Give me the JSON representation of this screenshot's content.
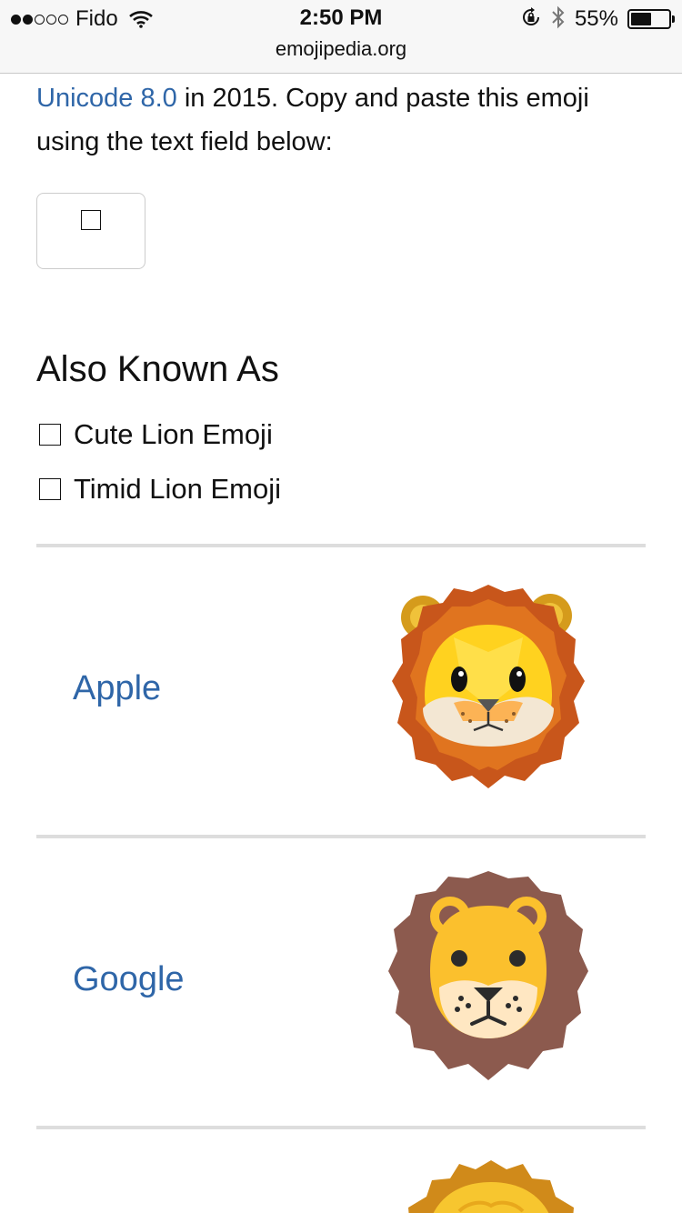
{
  "status_bar": {
    "carrier": "Fido",
    "time": "2:50 PM",
    "battery_percent": "55%",
    "battery_level": 0.55,
    "signal_strength": 2,
    "signal_max": 5
  },
  "browser": {
    "url": "emojipedia.org"
  },
  "intro": {
    "link_text": "Unicode 8.0",
    "text": " in 2015. Copy and paste this emoji using the text field below:"
  },
  "copy_field": {
    "value": "□"
  },
  "also_known_as": {
    "heading": "Also Known As",
    "items": [
      {
        "label": "Cute Lion Emoji"
      },
      {
        "label": "Timid Lion Emoji"
      }
    ]
  },
  "vendors": [
    {
      "name": "Apple",
      "image": "apple-lion-face-emoji"
    },
    {
      "name": "Google",
      "image": "google-lion-face-emoji"
    },
    {
      "name": "",
      "image": "next-vendor-lion-face-emoji"
    }
  ],
  "colors": {
    "link": "#2f66a8",
    "divider": "#dddddd",
    "text": "#111111"
  },
  "icons": {
    "wifi": "wifi-icon",
    "lock_rotation": "rotation-lock-icon",
    "bluetooth": "bluetooth-icon",
    "battery": "battery-icon"
  }
}
